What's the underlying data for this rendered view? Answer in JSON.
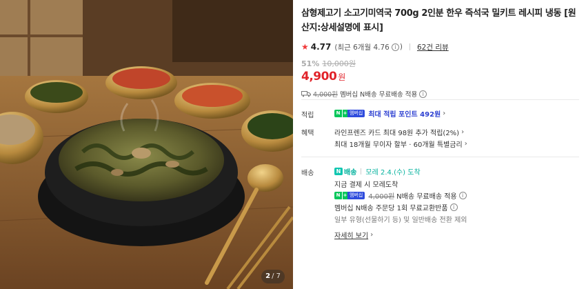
{
  "image": {
    "alt": "소고기 미역국",
    "counter": {
      "current": "2",
      "total": "/ 7"
    }
  },
  "product": {
    "title": "삼형제고기 소고기미역국 700g 2인분 한우 즉석국 밀키트 레시피 냉동 [원산지:상세설명에 표시]",
    "rating": {
      "star_icon": "star-icon",
      "score": "4.77",
      "recent": "(최근 6개월 4.76",
      "recent_close": ")",
      "reviews": "62건 리뷰"
    },
    "price": {
      "discount_rate": "51%",
      "original": "10,000원",
      "sale": "4,900",
      "unit": "원",
      "accent_color": "#e1232a"
    },
    "member_shipping": {
      "strike": "4,000원",
      "text": "멤버십 N배송 무료배송 적용"
    }
  },
  "sections": {
    "points": {
      "label": "적립",
      "badge_m": "멤버십",
      "text": "최대 적립 포인트 492원"
    },
    "benefits": {
      "label": "혜택",
      "line1": "라인프렌즈 카드 최대 98원 추가 적립(2%)",
      "line2": "최대 18개월 무이자 할부 · 60개월 특별금리"
    },
    "delivery": {
      "label": "배송",
      "tag": "N배송",
      "tag_n": "N",
      "tag_rest": "배송",
      "arrival": "모레 2.4.(수) 도착",
      "line_pay": "지금 결제 시 모레도착",
      "badge_m": "멤버십",
      "strike": "4,000원",
      "free": "N배송 무료배송 적용",
      "return": "멤버십 N배송 주문당 1회 무료교환반품",
      "exclude": "일부 유형(선물하기 등) 및 일반배송 전환 제외",
      "more": "자세히 보기"
    }
  }
}
